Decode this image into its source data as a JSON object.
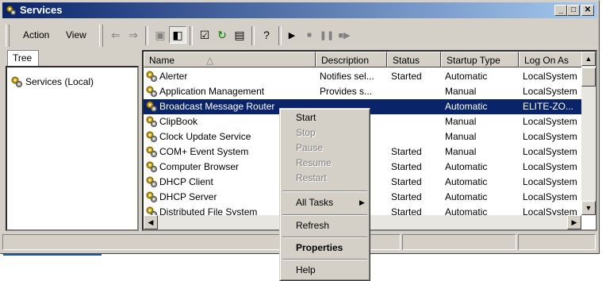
{
  "window": {
    "title": "Services",
    "icon": "services-gear-icon"
  },
  "menu": {
    "action": "Action",
    "view": "View"
  },
  "toolbar": {
    "buttons": [
      "back-arrow-icon",
      "forward-arrow-icon",
      "up-folder-icon",
      "show-hide-tree-icon",
      "properties-icon",
      "refresh-icon",
      "export-list-icon",
      "help-icon",
      "start-service-icon",
      "stop-service-icon",
      "pause-service-icon",
      "restart-service-icon"
    ]
  },
  "tree": {
    "tab": "Tree",
    "root": "Services (Local)"
  },
  "columns": {
    "name": "Name",
    "description": "Description",
    "status": "Status",
    "startup": "Startup Type",
    "logon": "Log On As"
  },
  "services": [
    {
      "name": "Alerter",
      "description": "Notifies sel...",
      "status": "Started",
      "startup": "Automatic",
      "logon": "LocalSystem"
    },
    {
      "name": "Application Management",
      "description": "Provides s...",
      "status": "",
      "startup": "Manual",
      "logon": "LocalSystem"
    },
    {
      "name": "Broadcast Message Router",
      "description": "",
      "status": "",
      "startup": "Automatic",
      "logon": "ELITE-ZO...",
      "selected": true
    },
    {
      "name": "ClipBook",
      "description": "...",
      "status": "",
      "startup": "Manual",
      "logon": "LocalSystem"
    },
    {
      "name": "Clock Update Service",
      "description": "",
      "status": "",
      "startup": "Manual",
      "logon": "LocalSystem"
    },
    {
      "name": "COM+ Event System",
      "description": "..",
      "status": "Started",
      "startup": "Manual",
      "logon": "LocalSystem"
    },
    {
      "name": "Computer Browser",
      "description": "...",
      "status": "Started",
      "startup": "Automatic",
      "logon": "LocalSystem"
    },
    {
      "name": "DHCP Client",
      "description": "...",
      "status": "Started",
      "startup": "Automatic",
      "logon": "LocalSystem"
    },
    {
      "name": "DHCP Server",
      "description": "..",
      "status": "Started",
      "startup": "Automatic",
      "logon": "LocalSystem"
    },
    {
      "name": "Distributed File System",
      "description": "...",
      "status": "Started",
      "startup": "Automatic",
      "logon": "LocalSystem"
    }
  ],
  "context_menu": {
    "start": "Start",
    "stop": "Stop",
    "pause": "Pause",
    "resume": "Resume",
    "restart": "Restart",
    "all_tasks": "All Tasks",
    "refresh": "Refresh",
    "properties": "Properties",
    "help": "Help"
  },
  "colors": {
    "titlebar_start": "#0a246a",
    "titlebar_end": "#a6caf0",
    "selection": "#0a246a",
    "face": "#d4d0c8"
  }
}
